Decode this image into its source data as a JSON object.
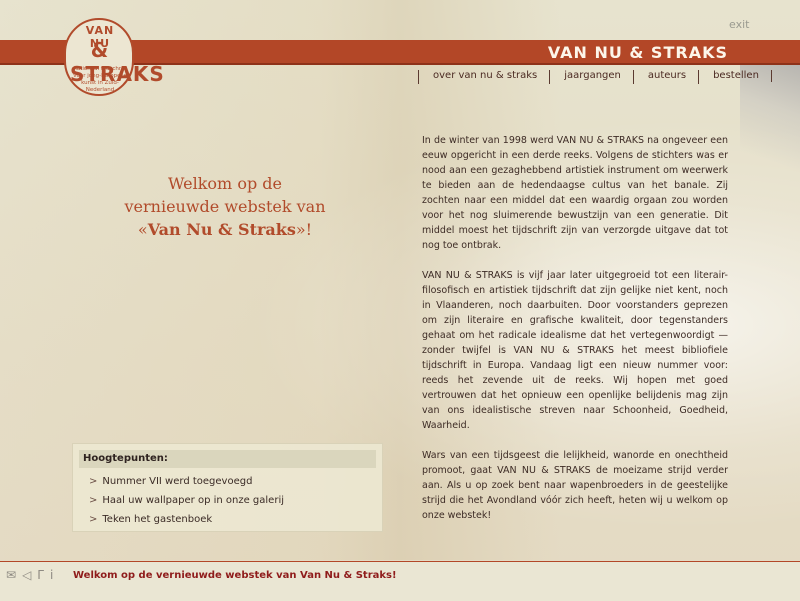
{
  "logo": {
    "line1": "VAN NU",
    "line2": "& STRAKS",
    "line3": "nationaal tijdschrift voor jong-Europese kunst in Zuid-Nederland"
  },
  "header": {
    "exit_label": "exit",
    "title": "VAN NU & STRAKS"
  },
  "nav": {
    "items": [
      {
        "label": "over van nu & straks"
      },
      {
        "label": "jaargangen"
      },
      {
        "label": "auteurs"
      },
      {
        "label": "bestellen"
      }
    ]
  },
  "welcome": {
    "line1": "Welkom op de",
    "line2": "vernieuwde webstek van",
    "quote_open": "«",
    "name": "Van Nu & Straks",
    "quote_close": "»!"
  },
  "article": {
    "paragraphs": [
      "In de winter van 1998 werd VAN NU & STRAKS na ongeveer een eeuw opgericht in een derde reeks. Volgens de stichters was er nood aan een gezaghebbend artistiek instrument om weerwerk te bieden aan de hedendaagse cultus van het banale. Zij zochten naar een middel dat een waardig orgaan zou worden voor het nog sluimerende bewustzijn van een generatie. Dit middel moest het tijdschrift zijn van verzorgde uitgave dat tot nog toe ontbrak.",
      "VAN NU & STRAKS is vijf jaar later uitgegroeid tot een literair-filosofisch en artistiek tijdschrift dat zijn gelijke niet kent, noch in Vlaanderen, noch daarbuiten. Door voorstanders geprezen om zijn literaire en grafische kwaliteit, door tegenstanders gehaat om het radicale idealisme dat het vertegenwoordigt — zonder twijfel is VAN NU & STRAKS het meest bibliofiele tijdschrift in Europa. Vandaag ligt een nieuw nummer voor: reeds het zevende uit de reeks. Wij hopen met goed vertrouwen dat het opnieuw een openlijke belijdenis mag zijn van ons idealistische streven naar Schoonheid, Goedheid, Waarheid.",
      "Wars van een tijdsgeest die lelijkheid, wanorde en onechtheid promoot, gaat VAN NU & STRAKS de moeizame strijd verder aan. Als u op zoek bent naar wapenbroeders in de geestelijke strijd die het Avondland vóór zich heeft, heten wij u welkom op onze webstek!"
    ]
  },
  "highlights": {
    "title": "Hoogtepunten:",
    "items": [
      {
        "label": "Nummer VII werd toegevoegd"
      },
      {
        "label": "Haal uw wallpaper op in onze galerij"
      },
      {
        "label": "Teken het gastenboek"
      }
    ],
    "bullet": ">"
  },
  "footer": {
    "icons": [
      "mail-icon",
      "sound-icon",
      "cursor-icon",
      "info-icon"
    ],
    "status": "Welkom op de vernieuwde webstek van Van Nu & Straks!"
  },
  "colors": {
    "accent": "#b34727",
    "status_text": "#8f1c1b",
    "background": "#e7e3ce"
  }
}
